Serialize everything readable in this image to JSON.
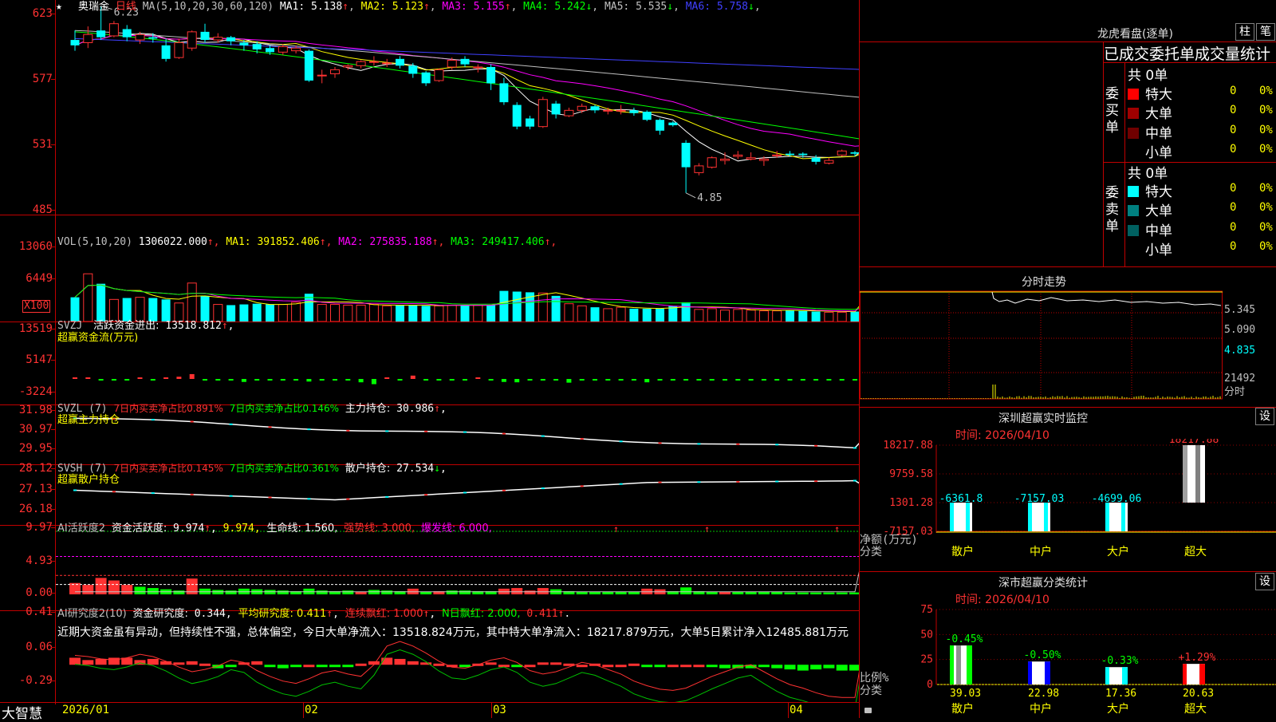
{
  "stock": {
    "star": "★",
    "name": "奥瑞金",
    "period": "日线",
    "ma_header": "MA(5,10,20,30,60,120)",
    "ma": [
      {
        "label": "MA1:",
        "value": "5.138",
        "arrow": "↑",
        "color": "#ffffff"
      },
      {
        "label": "MA2:",
        "value": "5.123",
        "arrow": "↑",
        "color": "#ffff00"
      },
      {
        "label": "MA3:",
        "value": "5.155",
        "arrow": "↑",
        "color": "#ff00ff"
      },
      {
        "label": "MA4:",
        "value": "5.242",
        "arrow": "↓",
        "color": "#00ff00"
      },
      {
        "label": "MA5:",
        "value": "5.535",
        "arrow": "↓",
        "color": "#c0c0c0"
      },
      {
        "label": "MA6:",
        "value": "5.758",
        "arrow": "↓",
        "color": "#4040ff"
      }
    ],
    "high_mark": "6.23",
    "low_mark": "4.85",
    "y_ticks": [
      "623",
      "577",
      "531",
      "485"
    ]
  },
  "vol": {
    "header_name": "VOL(5,10,20)",
    "header_value": "1306022.000",
    "ma": [
      {
        "label": "MA1:",
        "value": "391852.406",
        "color": "#ffff00"
      },
      {
        "label": "MA2:",
        "value": "275835.188",
        "color": "#ff00ff"
      },
      {
        "label": "MA3:",
        "value": "249417.406",
        "color": "#00ff00"
      }
    ],
    "y_ticks": [
      "13060",
      "6449"
    ],
    "unit": "X100"
  },
  "svzj": {
    "name": "SVZJ",
    "label": "活跃资金进出:",
    "value": "13518.812",
    "subtitle": "超赢资金流(万元)",
    "y_ticks": [
      "13519",
      "5147",
      "-3224"
    ]
  },
  "svzl": {
    "name": "SVZL",
    "period": "(7)",
    "l1": "7日内买卖净占比0.891%",
    "l2": "7日内买卖净占比0.146%",
    "l3": "主力持仓:",
    "value": "30.986",
    "subtitle": "超赢主力持仓",
    "y_ticks": [
      "31.98",
      "30.97",
      "29.95"
    ]
  },
  "svsh": {
    "name": "SVSH",
    "period": "(7)",
    "l1": "7日内买卖净占比0.145%",
    "l2": "7日内买卖净占比0.361%",
    "l3": "散户持仓:",
    "value": "27.534",
    "subtitle": "超赢散户持仓",
    "y_ticks": [
      "28.12",
      "27.13",
      "26.18"
    ]
  },
  "ai1": {
    "name": "AI活跃度2",
    "label": "资金活跃度:",
    "value": "9.974",
    "value2": "9.974,",
    "life": "生命线: 1.560,",
    "strong": "强势线: 3.000,",
    "burst": "爆发线: 6.000,",
    "y_ticks": [
      "9.97",
      "4.93",
      "0.00"
    ]
  },
  "ai2": {
    "name": "AI研究度2(10)",
    "label": "资金研究度:",
    "value": "0.344",
    "avg": "平均研究度: 0.411",
    "cont": "连续飘红: 1.000",
    "nday": "N日飘红: 2.000,",
    "nval": "0.411",
    "comment": "近期大资金虽有异动，但持续性不强，总体偏空，今日大单净流入：13518.824万元，其中特大单净流入：18217.879万元，大单5日累计净入12485.881万元",
    "y_ticks": [
      "0.41",
      "0.06",
      "-0.29"
    ]
  },
  "x_axis": {
    "labels": [
      "2026/01",
      "02",
      "03",
      "04"
    ],
    "brand": "大智慧"
  },
  "lhb": {
    "title": "龙虎看盘(逐单)",
    "btn1": "柱",
    "btn2": "笔",
    "subtitle": "已成交委托单成交量统计",
    "buy_label": "委买单",
    "sell_label": "委卖单",
    "buy_total": "共 0单",
    "sell_total": "共 0单",
    "buy_rows": [
      {
        "name": "特大",
        "num": "0",
        "pct": "0%",
        "color": "#ff0000"
      },
      {
        "name": "大单",
        "num": "0",
        "pct": "0%",
        "color": "#a00000"
      },
      {
        "name": "中单",
        "num": "0",
        "pct": "0%",
        "color": "#700000"
      },
      {
        "name": "小单",
        "num": "0",
        "pct": "0%",
        "color": "#000000"
      }
    ],
    "sell_rows": [
      {
        "name": "特大",
        "num": "0",
        "pct": "0%",
        "color": "#00ffff"
      },
      {
        "name": "大单",
        "num": "0",
        "pct": "0%",
        "color": "#008080"
      },
      {
        "name": "中单",
        "num": "0",
        "pct": "0%",
        "color": "#006060"
      },
      {
        "name": "小单",
        "num": "0",
        "pct": "0%",
        "color": "#000000"
      }
    ]
  },
  "intraday": {
    "title": "分时走势",
    "y_ticks": [
      "5.345",
      "5.090",
      "4.835"
    ],
    "vol_label": "21492",
    "vol_unit": "分时"
  },
  "monitor": {
    "title": "深圳超赢实时监控",
    "btn": "设",
    "time": "时间: 2026/04/10",
    "y_ticks": [
      "18217.88",
      "9759.58",
      "1301.28",
      "-7157.03"
    ],
    "axis_label1": "净额(万元)",
    "axis_label2": "分类",
    "chart_data": {
      "type": "bar",
      "categories": [
        "散户",
        "中户",
        "大户",
        "超大"
      ],
      "values": [
        -6361.8,
        -7157.03,
        -4699.06,
        18217.88
      ],
      "value_labels": [
        "-6361.8",
        "-7157.03",
        "-4699.06",
        "18217.88"
      ],
      "ylim": [
        -7157.03,
        18217.88
      ]
    }
  },
  "classify": {
    "title": "深市超赢分类统计",
    "btn": "设",
    "time": "时间: 2026/04/10",
    "y_ticks": [
      "75",
      "50",
      "25",
      "0"
    ],
    "axis_label1": "比例%",
    "axis_label2": "分类",
    "chart_data": {
      "type": "bar",
      "categories": [
        "散户",
        "中户",
        "大户",
        "超大"
      ],
      "values": [
        39.03,
        22.98,
        17.36,
        20.63
      ],
      "changes": [
        "-0.45%",
        "-0.50%",
        "-0.33%",
        "+1.29%"
      ],
      "value_labels": [
        "39.03",
        "22.98",
        "17.36",
        "20.63"
      ],
      "ylim": [
        0,
        75
      ]
    }
  },
  "colors": {
    "up": "#ff3232",
    "down": "#00ffff",
    "grid": "#8b0000",
    "frame": "#c00000"
  }
}
